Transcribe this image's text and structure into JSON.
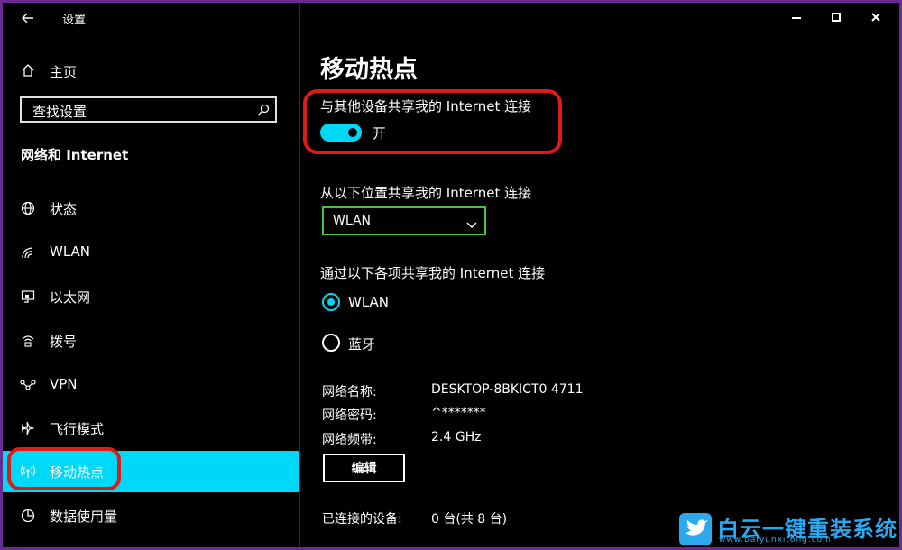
{
  "app": {
    "title": "设置"
  },
  "sidebar": {
    "home_label": "主页",
    "search_placeholder": "查找设置",
    "section_title": "网络和 Internet",
    "items": [
      {
        "label": "状态",
        "icon": "globe-icon"
      },
      {
        "label": "WLAN",
        "icon": "wifi-icon"
      },
      {
        "label": "以太网",
        "icon": "ethernet-icon"
      },
      {
        "label": "拨号",
        "icon": "dialup-icon"
      },
      {
        "label": "VPN",
        "icon": "vpn-icon"
      },
      {
        "label": "飞行模式",
        "icon": "airplane-icon"
      },
      {
        "label": "移动热点",
        "icon": "hotspot-icon",
        "active": true
      },
      {
        "label": "数据使用量",
        "icon": "data-usage-icon"
      }
    ]
  },
  "main": {
    "title": "移动热点",
    "share_label": "与其他设备共享我的 Internet 连接",
    "toggle_state": "开",
    "share_from_label": "从以下位置共享我的 Internet 连接",
    "share_from_value": "WLAN",
    "share_over_label": "通过以下各项共享我的 Internet 连接",
    "share_over_options": [
      {
        "label": "WLAN",
        "selected": true
      },
      {
        "label": "蓝牙",
        "selected": false
      }
    ],
    "network_name_key": "网络名称:",
    "network_name_value": "DESKTOP-8BKICT0 4711",
    "network_password_key": "网络密码:",
    "network_password_value": "^*******",
    "network_band_key": "网络频带:",
    "network_band_value": "2.4 GHz",
    "edit_button": "编辑",
    "connected_key": "已连接的设备:",
    "connected_value": "0 台(共 8 台)"
  },
  "watermark": {
    "title": "白云一键重装系统",
    "url": "www.baiyunxitong.com"
  },
  "colors": {
    "accent": "#00d8f8",
    "highlight_ring": "#e01a1a",
    "select_border": "#3fc83a",
    "frame_border": "#6a2a93"
  }
}
